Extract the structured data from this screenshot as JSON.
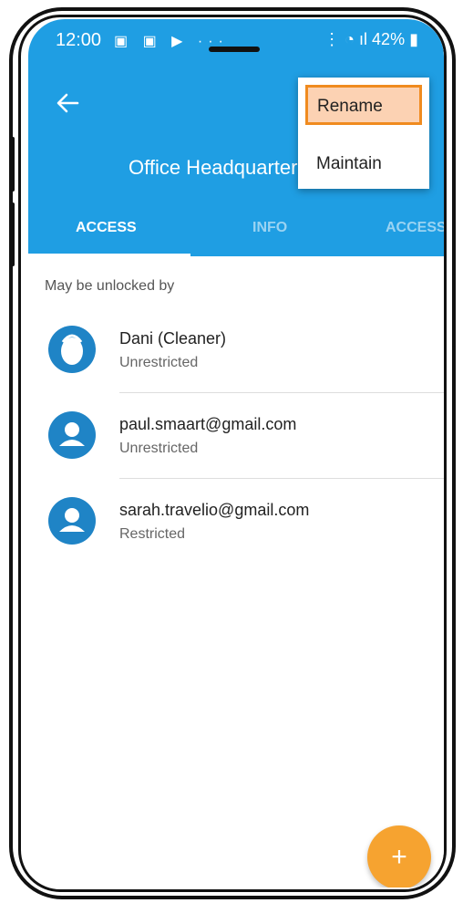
{
  "status_bar": {
    "time": "12:00",
    "left_icons": "▣ ▣ ▶ ···",
    "right_text": "42%"
  },
  "app_bar": {
    "title": "Office Headquarters",
    "back_icon": "arrow-left-icon"
  },
  "tabs": [
    {
      "label": "ACCESS",
      "active": true
    },
    {
      "label": "INFO",
      "active": false
    },
    {
      "label": "ACCESS",
      "active": false
    }
  ],
  "overflow_menu": {
    "items": [
      {
        "label": "Rename",
        "highlighted": true
      },
      {
        "label": "Maintain",
        "highlighted": false
      }
    ]
  },
  "list": {
    "section_label": "May be unlocked by",
    "items": [
      {
        "name": "Dani (Cleaner)",
        "status": "Unrestricted",
        "icon": "keyfob-icon"
      },
      {
        "name": "paul.smaart@gmail.com",
        "status": "Unrestricted",
        "icon": "person-icon"
      },
      {
        "name": "sarah.travelio@gmail.com",
        "status": "Restricted",
        "icon": "person-icon"
      }
    ]
  },
  "fab": {
    "label": "+"
  },
  "colors": {
    "primary": "#1f9ee3",
    "accent": "#f6a330",
    "highlight_border": "#f08b1f",
    "highlight_fill": "#fcd2b3"
  }
}
